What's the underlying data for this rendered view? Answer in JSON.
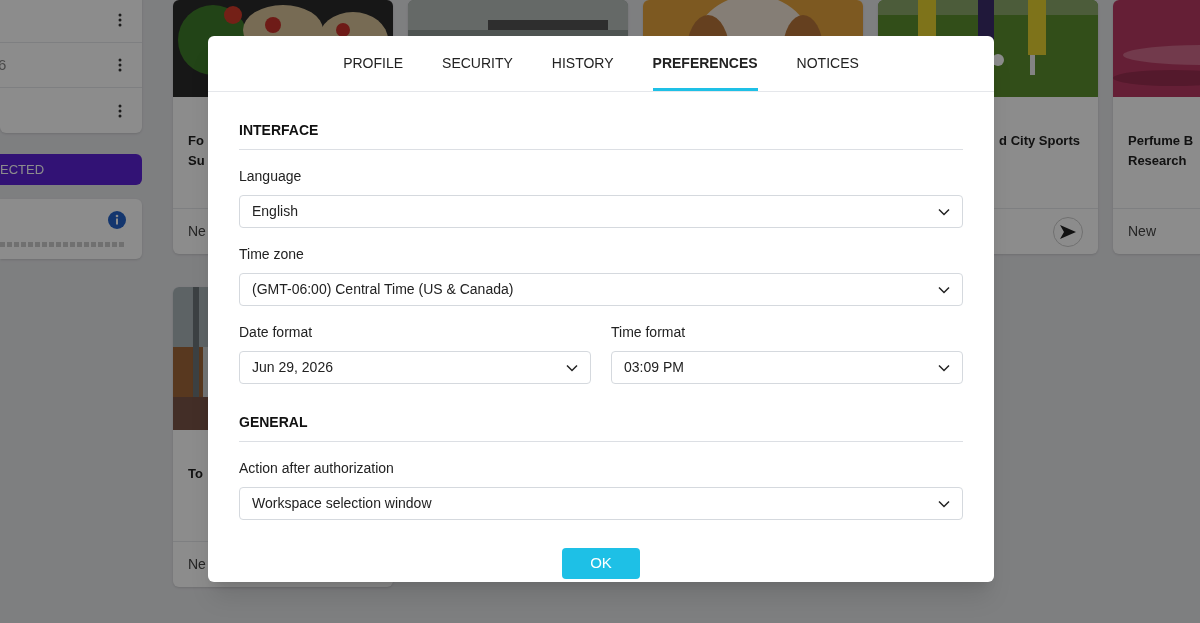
{
  "side_list": {
    "rows": [
      {
        "kind": "plain"
      },
      {
        "kind": "text",
        "text": "6"
      },
      {
        "kind": "plain"
      }
    ]
  },
  "side_button": {
    "label": "ECTED"
  },
  "info_card": {
    "kind": "info"
  },
  "card_rows": [
    [
      {
        "kind": "picture",
        "title_lines": [
          "Fo",
          "Su"
        ],
        "footer": "Ne"
      },
      {
        "kind": "picture"
      },
      {
        "kind": "picture"
      },
      {
        "kind": "picture",
        "title_lines": [
          "d City Sports"
        ],
        "send": true
      },
      {
        "kind": "picture",
        "title_lines": [
          "Perfume B",
          "Research"
        ],
        "footer": "New"
      }
    ],
    [
      {
        "kind": "picture",
        "title_lines": [
          "To"
        ],
        "footer": "Ne"
      }
    ]
  ],
  "dialog": {
    "tabs": [
      {
        "label": "PROFILE",
        "selected": false
      },
      {
        "label": "SECURITY",
        "selected": false
      },
      {
        "label": "HISTORY",
        "selected": false
      },
      {
        "label": "PREFERENCES",
        "selected": true
      },
      {
        "label": "NOTICES",
        "selected": false
      }
    ],
    "sections": [
      {
        "title": "INTERFACE",
        "rows": [
          [
            {
              "label": "Language",
              "value": "English"
            }
          ],
          [
            {
              "label": "Time zone",
              "value": "(GMT-06:00) Central Time (US & Canada)"
            }
          ],
          [
            {
              "label": "Date format",
              "value": "Jun 29, 2026"
            },
            {
              "label": "Time format",
              "value": "03:09 PM"
            }
          ]
        ]
      },
      {
        "title": "GENERAL",
        "rows": [
          [
            {
              "label": "Action after authorization",
              "value": "Workspace selection window"
            }
          ]
        ]
      }
    ],
    "ok": "OK"
  }
}
